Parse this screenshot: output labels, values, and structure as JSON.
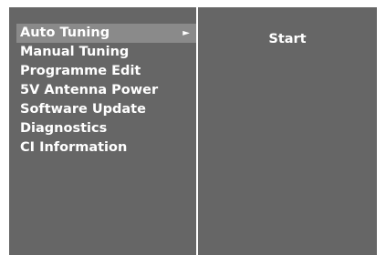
{
  "menu": {
    "items": [
      {
        "label": "Auto Tuning",
        "selected": true,
        "has_submenu": true
      },
      {
        "label": "Manual Tuning",
        "selected": false,
        "has_submenu": false
      },
      {
        "label": "Programme Edit",
        "selected": false,
        "has_submenu": false
      },
      {
        "label": "5V Antenna Power",
        "selected": false,
        "has_submenu": false
      },
      {
        "label": "Software Update",
        "selected": false,
        "has_submenu": false
      },
      {
        "label": "Diagnostics",
        "selected": false,
        "has_submenu": false
      },
      {
        "label": "CI Information",
        "selected": false,
        "has_submenu": false
      }
    ],
    "submenu_arrow_glyph": "►"
  },
  "detail": {
    "action_label": "Start"
  },
  "colors": {
    "panel_bg": "#666666",
    "highlight_bg": "#8a8a8a",
    "text": "#ffffff",
    "frame": "#ffffff"
  },
  "icons": {
    "submenu_arrow": "right-triangle-icon"
  }
}
